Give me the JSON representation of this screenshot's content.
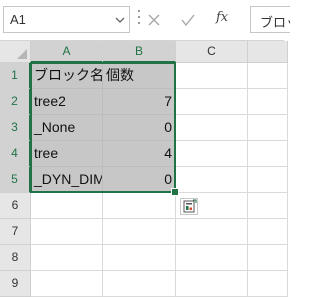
{
  "formula_bar": {
    "name_box": "A1",
    "cancel_icon": "close-icon",
    "enter_icon": "checkmark-icon",
    "function_label": "fx",
    "formula_value": "ブロック名"
  },
  "sheet": {
    "columns": [
      "A",
      "B",
      "C"
    ],
    "rows": [
      "1",
      "2",
      "3",
      "4",
      "5",
      "6",
      "7",
      "8",
      "9"
    ],
    "cells": [
      {
        "a": "ブロック名",
        "b": "個数"
      },
      {
        "a": "tree2",
        "b": "7"
      },
      {
        "a": "_None",
        "b": "0"
      },
      {
        "a": "tree",
        "b": "4"
      },
      {
        "a": "_DYN_DIM",
        "b": "0"
      }
    ]
  },
  "quick_analysis": {
    "icon": "quick-analysis-icon"
  },
  "colors": {
    "accent": "#217346",
    "header_bg": "#e6e6e6",
    "selected_header_bg": "#d2d2d2",
    "selected_cell_bg": "#c7c7c7"
  }
}
